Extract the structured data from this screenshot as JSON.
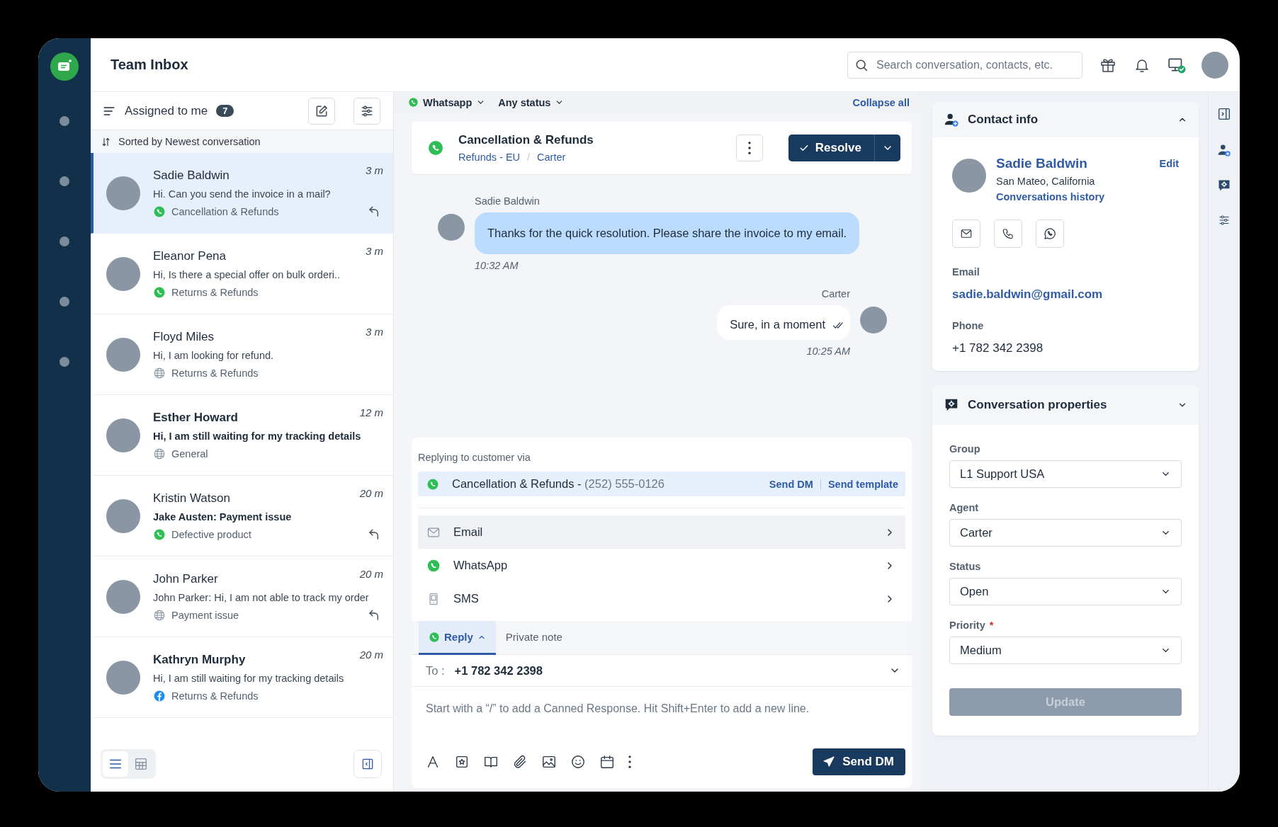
{
  "app": {
    "title": "Team Inbox",
    "search": {
      "placeholder": "Search conversation, contacts, etc."
    }
  },
  "inbox": {
    "filter": "Assigned to me",
    "count": "7",
    "sort": "Sorted by Newest conversation",
    "conversations": [
      {
        "name": "Sadie Baldwin",
        "preview": "Hi. Can you send the invoice in a mail?",
        "kind": "whatsapp",
        "tag": "Cancellation & Refunds",
        "time": "3 m",
        "bold_name": false,
        "bold_preview": false,
        "replied": true,
        "selected": true
      },
      {
        "name": "Eleanor Pena",
        "preview": "Hi, Is there a special offer on bulk orderi..",
        "kind": "whatsapp",
        "tag": "Returns & Refunds",
        "time": "3 m",
        "bold_name": false,
        "bold_preview": false,
        "replied": false,
        "selected": false
      },
      {
        "name": "Floyd Miles",
        "preview": "Hi, I am looking for refund.",
        "kind": "web",
        "tag": "Returns & Refunds",
        "time": "3 m",
        "bold_name": false,
        "bold_preview": false,
        "replied": false,
        "selected": false
      },
      {
        "name": "Esther Howard",
        "preview": "Hi, I am still waiting for my tracking details",
        "kind": "web",
        "tag": "General",
        "time": "12 m",
        "bold_name": true,
        "bold_preview": true,
        "replied": false,
        "selected": false
      },
      {
        "name": "Kristin Watson",
        "preview": "Jake Austen: Payment issue",
        "kind": "whatsapp",
        "tag": "Defective product",
        "time": "20 m",
        "bold_name": false,
        "bold_preview": true,
        "replied": true,
        "selected": false
      },
      {
        "name": "John Parker",
        "preview": "John Parker: Hi, I am not able to track my order",
        "kind": "web",
        "tag": "Payment issue",
        "time": "20 m",
        "bold_name": false,
        "bold_preview": false,
        "replied": true,
        "selected": false
      },
      {
        "name": "Kathryn Murphy",
        "preview": "Hi, I am still waiting for my tracking details",
        "kind": "facebook",
        "tag": "Returns & Refunds",
        "time": "20 m",
        "bold_name": true,
        "bold_preview": false,
        "replied": false,
        "selected": false
      }
    ],
    "view_toggle": [
      {
        "kind": "list",
        "selected": true
      },
      {
        "kind": "grid",
        "selected": false
      }
    ]
  },
  "conversation": {
    "filters": [
      {
        "kind": "whatsapp",
        "label": "Whatsapp"
      },
      {
        "kind": "plain",
        "label": "Any status"
      }
    ],
    "collapse": "Collapse all",
    "title": "Cancellation & Refunds",
    "group": "Refunds - EU",
    "separator": "/",
    "agent": "Carter",
    "resolve": "Resolve",
    "messages": [
      {
        "kind": "in",
        "sender": "Sadie Baldwin",
        "text": "Thanks for the quick resolution. Please share the invoice to my email.",
        "time": "10:32 AM"
      },
      {
        "kind": "out",
        "sender": "Carter",
        "text": "Sure, in a moment",
        "time": "10:25 AM",
        "read": true
      }
    ]
  },
  "reply": {
    "via_label": "Replying to customer via",
    "channel": {
      "name": "Cancellation & Refunds - ",
      "number": "(252) 555-0126"
    },
    "actions": [
      "Send DM",
      "Send template"
    ],
    "channels": [
      {
        "kind": "email",
        "label": "Email",
        "highlighted": true
      },
      {
        "kind": "whatsapp",
        "label": "WhatsApp",
        "highlighted": false
      },
      {
        "kind": "sms",
        "label": "SMS",
        "highlighted": false
      }
    ],
    "tabs": [
      {
        "kind": "whatsapp",
        "label": "Reply",
        "selected": true
      },
      {
        "kind": "plain",
        "label": "Private note",
        "selected": false
      }
    ],
    "to_label": "To :",
    "to": "+1 782 342 2398",
    "placeholder": "Start with a “/” to add a Canned Response. Hit Shift+Enter to add a new line.",
    "send": "Send DM"
  },
  "contact": {
    "title": "Contact info",
    "name": "Sadie Baldwin",
    "location": "San Mateo, California",
    "history": "Conversations history",
    "edit": "Edit",
    "fields": [
      {
        "kind": "link",
        "label": "Email",
        "value": "sadie.baldwin@gmail.com"
      },
      {
        "kind": "text",
        "label": "Phone",
        "value": "+1 782 342 2398"
      }
    ]
  },
  "properties": {
    "title": "Conversation properties",
    "fields": [
      {
        "label": "Group",
        "value": "L1 Support USA"
      },
      {
        "label": "Agent",
        "value": "Carter"
      },
      {
        "label": "Status",
        "value": "Open"
      },
      {
        "label": "Priority",
        "value": "Medium",
        "marker": "*"
      }
    ],
    "update": {
      "label": "Update",
      "disabled": true
    }
  }
}
